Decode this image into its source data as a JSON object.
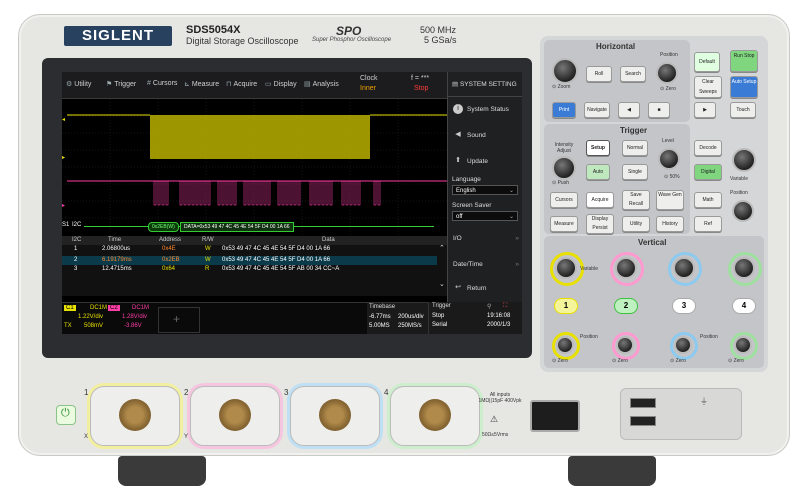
{
  "brand": {
    "logo": "SIGLENT",
    "model": "SDS5054X",
    "subtitle": "Digital Storage Oscilloscope",
    "spo": "SPO",
    "spo_sub": "Super Phosphor Oscilloscope",
    "bandwidth": "500 MHz",
    "sample_rate": "5 GSa/s"
  },
  "menu": {
    "utility": "Utility",
    "trigger": "Trigger",
    "cursors": "Cursors",
    "measure": "Measure",
    "acquire": "Acquire",
    "display": "Display",
    "analysis": "Analysis",
    "clock_label": "Clock",
    "clock_value": "Inner",
    "f_label": "f = ***",
    "f_value": "Stop"
  },
  "system": {
    "title": "SYSTEM SETTING",
    "status": "System Status",
    "sound": "Sound",
    "update": "Update",
    "language_label": "Language",
    "language_value": "English",
    "saver_label": "Screen Saver",
    "saver_value": "off",
    "io": "I/O",
    "datetime": "Date/Time",
    "return": "Return"
  },
  "decode": {
    "label": "S1",
    "bus": "I2C",
    "packet": "0x2EB(W)",
    "bar_text": "DATA=0x53 49 47 4C 45 4E 54 5F D4 00 1A 66",
    "headers": [
      "I2C",
      "Time",
      "Address",
      "R/W",
      "Data"
    ],
    "rows": [
      {
        "n": "1",
        "time": "2.06800us",
        "addr": "0x4E",
        "rw": "W",
        "data": "0x53 49 47 4C 45 4E 54 5F D4 00 1A 66"
      },
      {
        "n": "2",
        "time": "6.19179ms",
        "addr": "0x2EB",
        "rw": "W",
        "data": "0x53 49 47 4C 45 4E 54 5F D4 00 1A 66"
      },
      {
        "n": "3",
        "time": "12.4715ms",
        "addr": "0x64",
        "rw": "R",
        "data": "0x53 49 47 4C 45 4E 54 5F AB 00 34 CC~A"
      }
    ]
  },
  "bottom": {
    "c1": "C1",
    "c1_coupling": "DC1M",
    "c1_scale": "1.22V/div",
    "c1_offset": "508mV",
    "c2": "C2",
    "c2_coupling": "DC1M",
    "c2_scale": "1.28V/div",
    "c2_offset": "-3.86V",
    "tx": "TX",
    "timebase_label": "Timebase",
    "tb_delay": "-6.77ms",
    "tb_scale": "200us/div",
    "tb_mem": "5.00MS",
    "tb_rate": "250MS/s",
    "trigger_label": "Trigger",
    "trig_state": "Stop",
    "trig_type": "Serial",
    "clock": "19:16:08",
    "date": "2000/1/3"
  },
  "panel": {
    "horizontal": "Horizontal",
    "trigger": "Trigger",
    "vertical": "Vertical",
    "zoom": "Zoom",
    "roll": "Roll",
    "search": "Search",
    "position": "Position",
    "default": "Default",
    "run_stop": "Run Stop",
    "clear_sweeps": "Clear Sweeps",
    "auto_setup": "Auto Setup",
    "print": "Print",
    "navigate": "Navigate",
    "touch": "Touch",
    "intensity": "Intensity Adjust",
    "setup": "Setup",
    "normal": "Normal",
    "level": "Level",
    "decode_btn": "Decode",
    "auto": "Auto",
    "single": "Single",
    "fifty": "50%",
    "digital": "Digital",
    "variable": "Variable",
    "cursors": "Cursors",
    "acquire": "Acquire",
    "save_recall": "Save Recall",
    "wave_gen": "Wave Gen",
    "math": "Math",
    "measure": "Measure",
    "display_persist": "Display Persist",
    "utility": "Utility",
    "history": "History",
    "ref": "Ref",
    "push": "Push",
    "zero": "Zero",
    "ch1": "1",
    "ch2": "2",
    "ch3": "3",
    "ch4": "4"
  },
  "front": {
    "ch1": "1",
    "ch2": "2",
    "ch3": "3",
    "ch4": "4",
    "x": "X",
    "y": "Y",
    "warning": "All inputs 1MΩ||15pF 400Vpk",
    "cat": "50Ω≤5Vrms"
  },
  "colors": {
    "ch1": "#e8e000",
    "ch2": "#ff3da6",
    "ch3": "#3aa8e8",
    "ch4": "#40c040",
    "decode": "#3c3"
  }
}
